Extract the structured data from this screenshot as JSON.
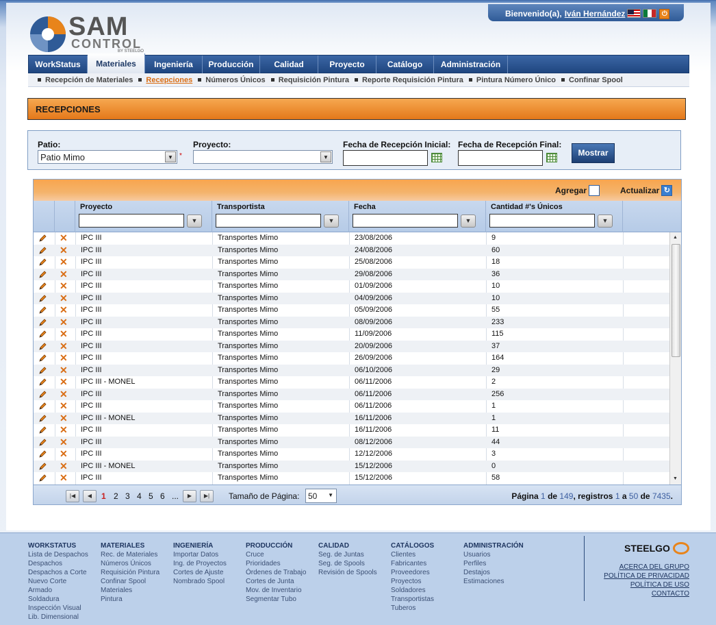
{
  "header": {
    "welcome": "Bienvenido(a),",
    "user": "Iván Hernández",
    "logo_main": "SAM",
    "logo_sub": "CONTROL",
    "logo_by": "BY STEELGO"
  },
  "nav": {
    "tabs": [
      "WorkStatus",
      "Materiales",
      "Ingeniería",
      "Producción",
      "Calidad",
      "Proyecto",
      "Catálogo",
      "Administración"
    ],
    "active": "Materiales"
  },
  "subnav": [
    "Recepción de Materiales",
    "Recepciones",
    "Números Únicos",
    "Requisición Pintura",
    "Reporte Requisición Pintura",
    "Pintura Número Único",
    "Confinar Spool"
  ],
  "page_title": "RECEPCIONES",
  "filters": {
    "patio_label": "Patio:",
    "patio_value": "Patio Mimo",
    "required_mark": "*",
    "proyecto_label": "Proyecto:",
    "proyecto_value": "",
    "fecha_ini_label": "Fecha de Recepción Inicial:",
    "fecha_fin_label": "Fecha de Recepción Final:",
    "mostrar": "Mostrar"
  },
  "grid": {
    "agregar": "Agregar",
    "actualizar": "Actualizar",
    "columns": [
      "Proyecto",
      "Transportista",
      "Fecha",
      "Cantidad #'s Únicos"
    ],
    "rows": [
      [
        "IPC III",
        "Transportes Mimo",
        "23/08/2006",
        "9"
      ],
      [
        "IPC III",
        "Transportes Mimo",
        "24/08/2006",
        "60"
      ],
      [
        "IPC III",
        "Transportes Mimo",
        "25/08/2006",
        "18"
      ],
      [
        "IPC III",
        "Transportes Mimo",
        "29/08/2006",
        "36"
      ],
      [
        "IPC III",
        "Transportes Mimo",
        "01/09/2006",
        "10"
      ],
      [
        "IPC III",
        "Transportes Mimo",
        "04/09/2006",
        "10"
      ],
      [
        "IPC III",
        "Transportes Mimo",
        "05/09/2006",
        "55"
      ],
      [
        "IPC III",
        "Transportes Mimo",
        "08/09/2006",
        "233"
      ],
      [
        "IPC III",
        "Transportes Mimo",
        "11/09/2006",
        "115"
      ],
      [
        "IPC III",
        "Transportes Mimo",
        "20/09/2006",
        "37"
      ],
      [
        "IPC III",
        "Transportes Mimo",
        "26/09/2006",
        "164"
      ],
      [
        "IPC III",
        "Transportes Mimo",
        "06/10/2006",
        "29"
      ],
      [
        "IPC III - MONEL",
        "Transportes Mimo",
        "06/11/2006",
        "2"
      ],
      [
        "IPC III",
        "Transportes Mimo",
        "06/11/2006",
        "256"
      ],
      [
        "IPC III",
        "Transportes Mimo",
        "06/11/2006",
        "1"
      ],
      [
        "IPC III - MONEL",
        "Transportes Mimo",
        "16/11/2006",
        "1"
      ],
      [
        "IPC III",
        "Transportes Mimo",
        "16/11/2006",
        "11"
      ],
      [
        "IPC III",
        "Transportes Mimo",
        "08/12/2006",
        "44"
      ],
      [
        "IPC III",
        "Transportes Mimo",
        "12/12/2006",
        "3"
      ],
      [
        "IPC III - MONEL",
        "Transportes Mimo",
        "15/12/2006",
        "0"
      ],
      [
        "IPC III",
        "Transportes Mimo",
        "15/12/2006",
        "58"
      ]
    ]
  },
  "pager": {
    "pages": [
      "1",
      "2",
      "3",
      "4",
      "5",
      "6",
      "..."
    ],
    "current": "1",
    "page_size_label": "Tamaño de Página:",
    "page_size": "50",
    "info_prefix": "Página",
    "info_page": "1",
    "info_de": "de",
    "info_total_pages": "149",
    "info_registros": ", registros",
    "info_from": "1",
    "info_a": "a",
    "info_to": "50",
    "info_de2": "de",
    "info_total": "7435",
    "info_end": "."
  },
  "footer": {
    "columns": [
      {
        "title": "WORKSTATUS",
        "items": [
          "Lista de Despachos",
          "Despachos",
          "Despachos a Corte",
          "Nuevo Corte",
          "Armado",
          "Soldadura",
          "Inspección Visual",
          "Lib. Dimensional"
        ]
      },
      {
        "title": "MATERIALES",
        "items": [
          "Rec. de Materiales",
          "Números Únicos",
          "Requisición Pintura",
          "Confinar Spool",
          "Materiales",
          "Pintura"
        ]
      },
      {
        "title": "INGENIERÍA",
        "items": [
          "Importar Datos",
          "Ing. de Proyectos",
          "Cortes de Ajuste",
          "Nombrado Spool"
        ]
      },
      {
        "title": "PRODUCCIÓN",
        "items": [
          "Cruce",
          "Prioridades",
          "Órdenes de Trabajo",
          "Cortes de Junta",
          "Mov. de Inventario",
          "Segmentar Tubo"
        ]
      },
      {
        "title": "CALIDAD",
        "items": [
          "Seg. de Juntas",
          "Seg. de Spools",
          "Revisión de Spools"
        ]
      },
      {
        "title": "CATÁLOGOS",
        "items": [
          "Clientes",
          "Fabricantes",
          "Proveedores",
          "Proyectos",
          "Soldadores",
          "Transportistas",
          "Tuberos"
        ]
      },
      {
        "title": "ADMINISTRACIÓN",
        "items": [
          "Usuarios",
          "Perfiles",
          "Destajos",
          "Estimaciones"
        ]
      }
    ],
    "brand": "STEELGO",
    "links": [
      "ACERCA DEL GRUPO",
      "POLÍTICA DE PRIVACIDAD",
      "POLÍTICA DE USO",
      "CONTACTO"
    ]
  },
  "colors": {
    "accent_orange": "#e4781a",
    "nav_blue": "#1f4680",
    "link_orange": "#d96d14"
  }
}
